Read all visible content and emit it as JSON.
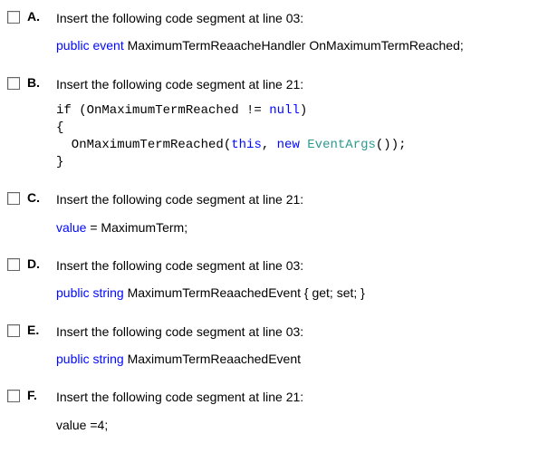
{
  "options": [
    {
      "letter": "A.",
      "statement": "Insert the following code segment at line 03:",
      "codeStyle": "sans",
      "code": [
        {
          "parts": [
            {
              "t": "public",
              "c": "kw-blue"
            },
            {
              "t": " "
            },
            {
              "t": "event",
              "c": "kw-blue"
            },
            {
              "t": " MaximumTermReaacheHandler OnMaximumTermReached;"
            }
          ]
        }
      ]
    },
    {
      "letter": "B.",
      "statement": "Insert the following code segment at line 21:",
      "codeStyle": "mono",
      "code": [
        {
          "parts": [
            {
              "t": "if (OnMaximumTermReached != "
            },
            {
              "t": "null",
              "c": "kw-blue"
            },
            {
              "t": ")"
            }
          ]
        },
        {
          "parts": [
            {
              "t": "{"
            }
          ]
        },
        {
          "parts": [
            {
              "t": "  OnMaximumTermReached("
            },
            {
              "t": "this",
              "c": "kw-blue"
            },
            {
              "t": ", "
            },
            {
              "t": "new",
              "c": "kw-blue"
            },
            {
              "t": " "
            },
            {
              "t": "EventArgs",
              "c": "kw-teal"
            },
            {
              "t": "());"
            }
          ]
        },
        {
          "parts": [
            {
              "t": "}"
            }
          ]
        }
      ]
    },
    {
      "letter": "C.",
      "statement": "Insert the following code segment at line 21:",
      "codeStyle": "sans",
      "code": [
        {
          "parts": [
            {
              "t": "value",
              "c": "kw-blue"
            },
            {
              "t": " = MaximumTerm;"
            }
          ]
        }
      ]
    },
    {
      "letter": "D.",
      "statement": "Insert the following code segment at line 03:",
      "codeStyle": "sans",
      "code": [
        {
          "parts": [
            {
              "t": "public",
              "c": "kw-blue"
            },
            {
              "t": " "
            },
            {
              "t": "string",
              "c": "kw-blue"
            },
            {
              "t": " MaximumTermReaachedEvent { get; set; }"
            }
          ]
        }
      ]
    },
    {
      "letter": "E.",
      "statement": "Insert the following code segment at line 03:",
      "codeStyle": "sans",
      "code": [
        {
          "parts": [
            {
              "t": "public",
              "c": "kw-blue"
            },
            {
              "t": " "
            },
            {
              "t": "string",
              "c": "kw-blue"
            },
            {
              "t": " MaximumTermReaachedEvent"
            }
          ]
        }
      ]
    },
    {
      "letter": "F.",
      "statement": "Insert the following code segment at line 21:",
      "codeStyle": "sans",
      "code": [
        {
          "parts": [
            {
              "t": "value =4;"
            }
          ]
        }
      ]
    }
  ]
}
